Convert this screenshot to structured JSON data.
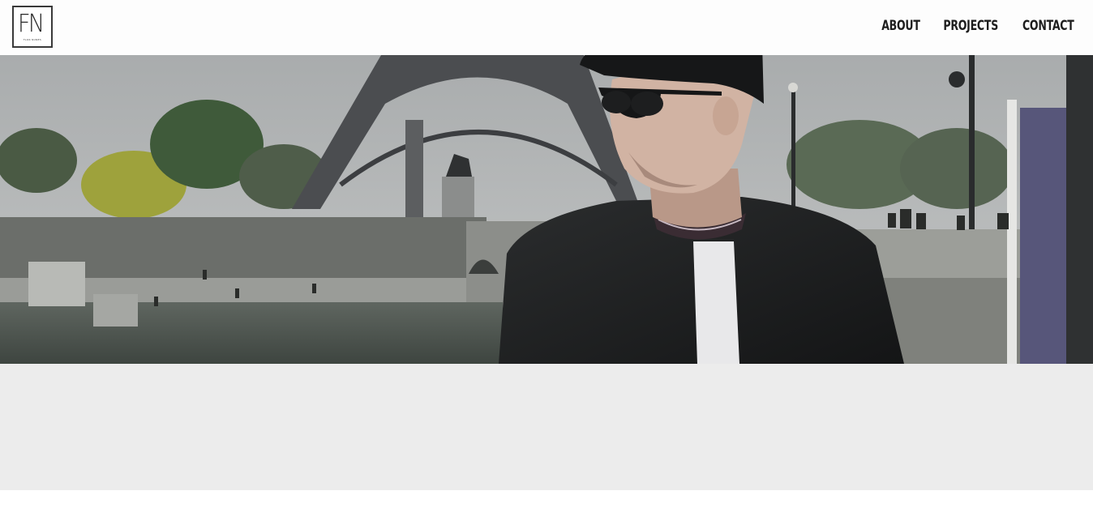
{
  "header": {
    "logo": {
      "letters": "FN",
      "subtitle": "FLOR NUNES"
    },
    "nav": [
      {
        "label": "ABOUT"
      },
      {
        "label": "PROJECTS"
      },
      {
        "label": "CONTACT"
      }
    ]
  },
  "hero": {
    "image_semantic": "hero-photo-eiffel-tower-portrait"
  },
  "colors": {
    "header_bg": "#fdfdfd",
    "band_bg": "#ececec",
    "nav_text": "#1e1e1e"
  }
}
